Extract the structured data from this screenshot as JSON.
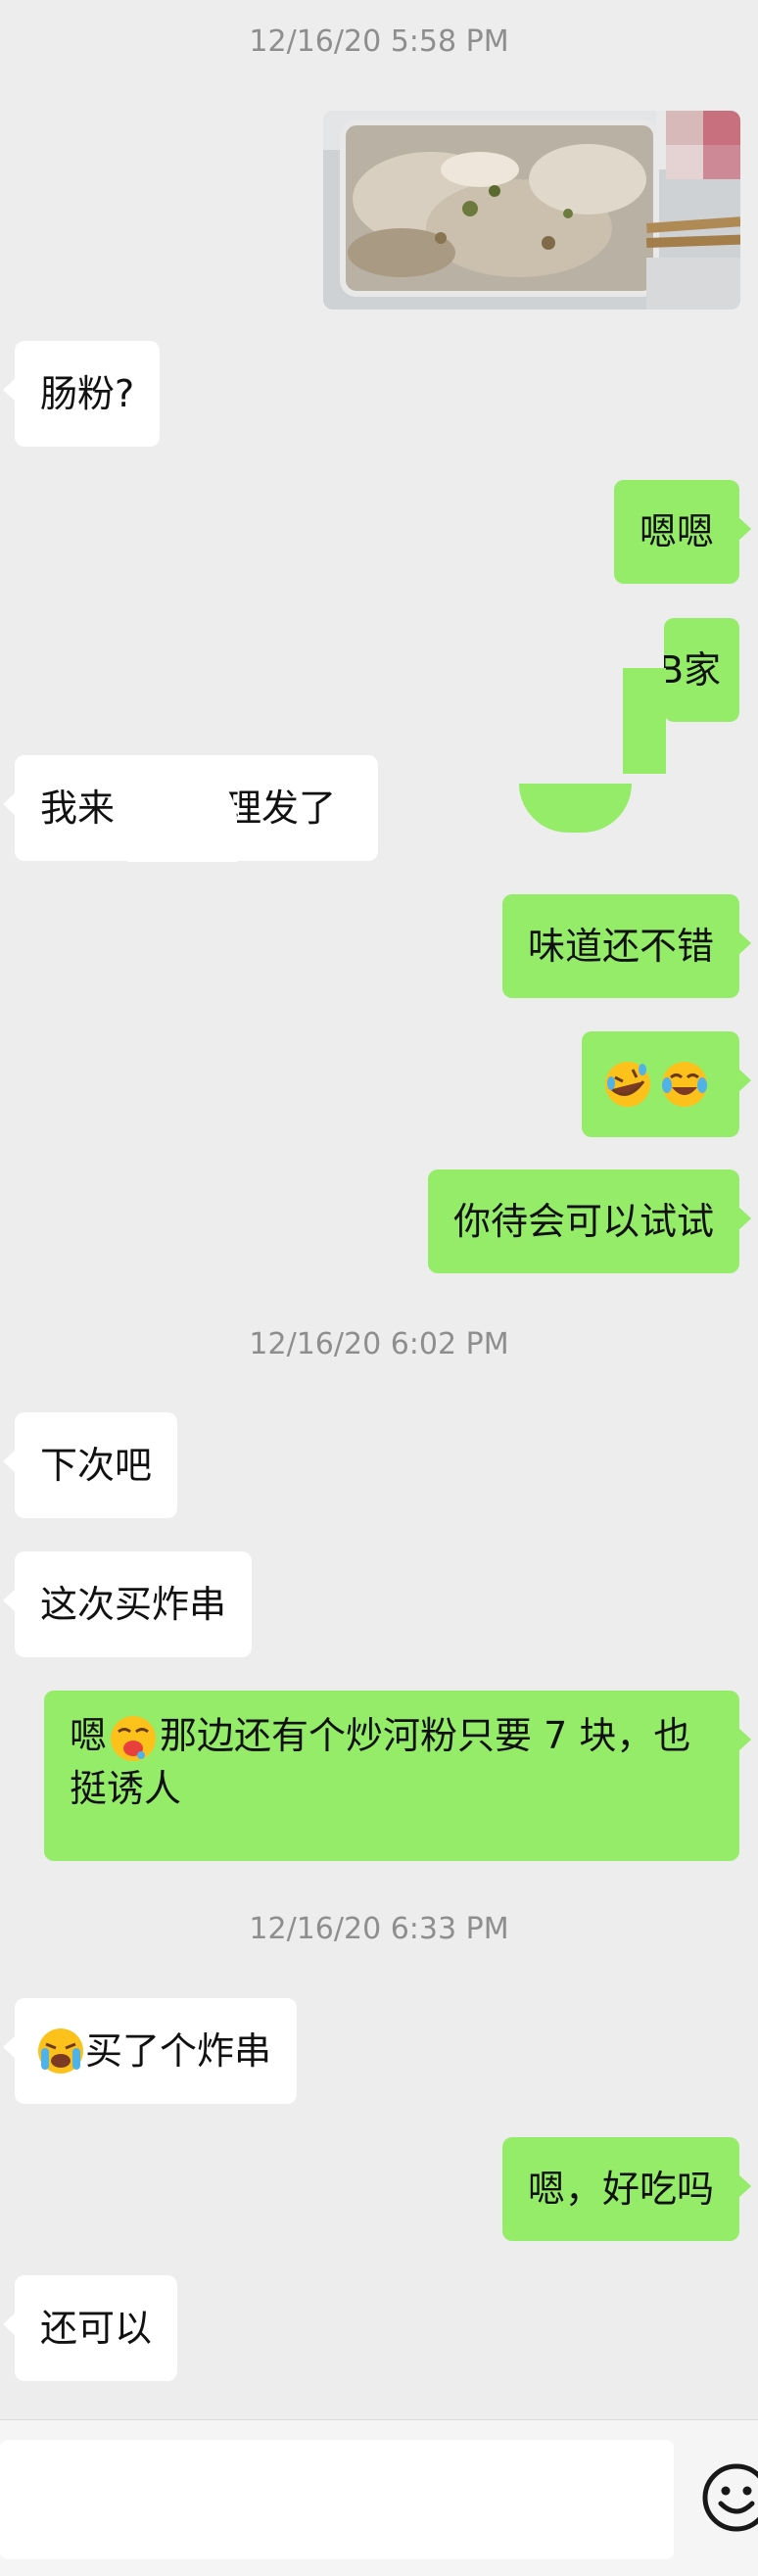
{
  "timestamps": [
    "12/16/20 5:58 PM",
    "12/16/20 6:02 PM",
    "12/16/20 6:33 PM"
  ],
  "messages": {
    "m1": "肠粉?",
    "m2": "嗯嗯",
    "m3": "B家",
    "m4a": "我来",
    "m4b": "理发了",
    "m5": "味道还不错",
    "m7": "你待会可以试试",
    "m8": "下次吧",
    "m9": "这次买炸串",
    "m10a": "嗯",
    "m10b": "那边还有个炒河粉只要 7 块，也挺诱人",
    "m11b": "买了个炸串",
    "m12": "嗯，好吃吗",
    "m13": "还可以"
  },
  "icons": {
    "emoji_rofl": "rolling-on-floor-laughing-emoji",
    "emoji_joy": "tears-of-joy-emoji",
    "emoji_drool": "drooling-face-emoji",
    "emoji_cry": "loudly-crying-emoji",
    "smiley": "emoji-keyboard-icon"
  },
  "colors": {
    "background": "#ededed",
    "outgoing_bubble": "#95ec69",
    "incoming_bubble": "#ffffff",
    "timestamp": "#8e8e8e"
  },
  "input": {
    "value": "",
    "placeholder": ""
  }
}
